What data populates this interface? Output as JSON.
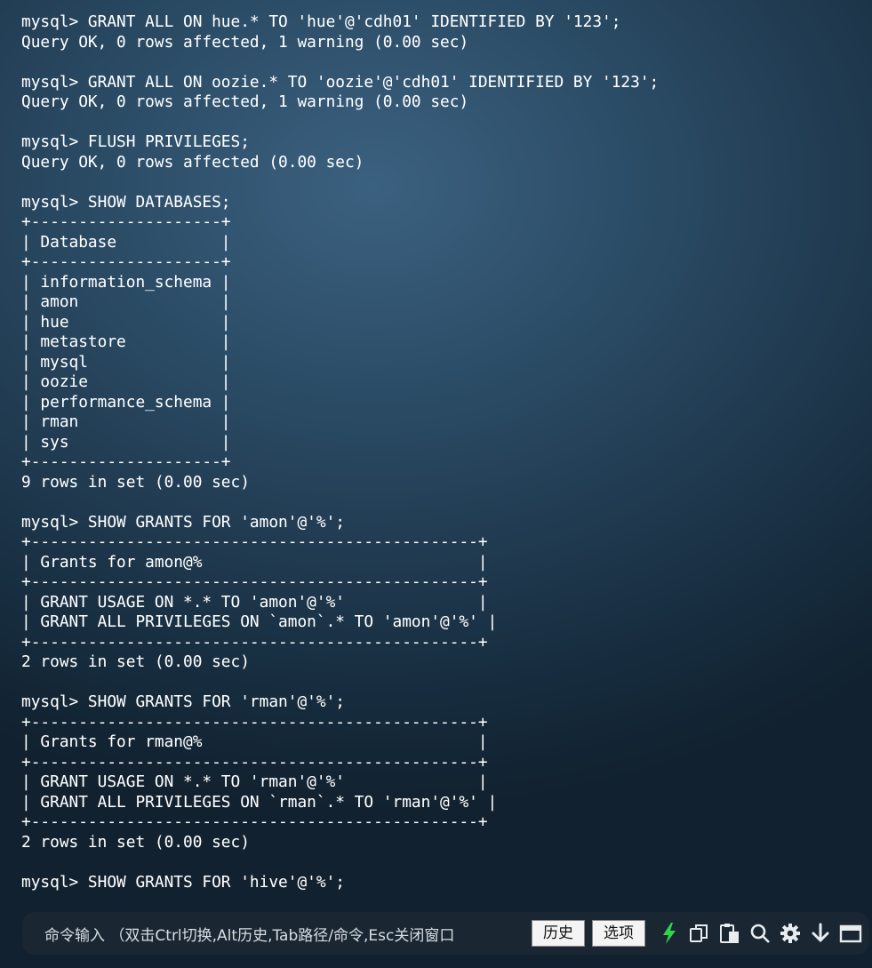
{
  "terminal": {
    "lines": [
      "mysql> GRANT ALL ON hue.* TO 'hue'@'cdh01' IDENTIFIED BY '123';",
      "Query OK, 0 rows affected, 1 warning (0.00 sec)",
      "",
      "mysql> GRANT ALL ON oozie.* TO 'oozie'@'cdh01' IDENTIFIED BY '123';",
      "Query OK, 0 rows affected, 1 warning (0.00 sec)",
      "",
      "mysql> FLUSH PRIVILEGES;",
      "Query OK, 0 rows affected (0.00 sec)",
      "",
      "mysql> SHOW DATABASES;",
      "+--------------------+",
      "| Database           |",
      "+--------------------+",
      "| information_schema |",
      "| amon               |",
      "| hue                |",
      "| metastore          |",
      "| mysql              |",
      "| oozie              |",
      "| performance_schema |",
      "| rman               |",
      "| sys                |",
      "+--------------------+",
      "9 rows in set (0.00 sec)",
      "",
      "mysql> SHOW GRANTS FOR 'amon'@'%';",
      "+-----------------------------------------------+",
      "| Grants for amon@%                             |",
      "+-----------------------------------------------+",
      "| GRANT USAGE ON *.* TO 'amon'@'%'              |",
      "| GRANT ALL PRIVILEGES ON `amon`.* TO 'amon'@'%' |",
      "+-----------------------------------------------+",
      "2 rows in set (0.00 sec)",
      "",
      "mysql> SHOW GRANTS FOR 'rman'@'%';",
      "+-----------------------------------------------+",
      "| Grants for rman@%                             |",
      "+-----------------------------------------------+",
      "| GRANT USAGE ON *.* TO 'rman'@'%'              |",
      "| GRANT ALL PRIVILEGES ON `rman`.* TO 'rman'@'%' |",
      "+-----------------------------------------------+",
      "2 rows in set (0.00 sec)",
      "",
      "mysql> SHOW GRANTS FOR 'hive'@'%';"
    ]
  },
  "command_bar": {
    "hint": "命令输入 （双击Ctrl切换,Alt历史,Tab路径/命令,Esc关闭窗口",
    "history_label": "历史",
    "options_label": "选项",
    "icons": [
      "lightning-icon",
      "copy-icon",
      "paste-icon",
      "search-icon",
      "gear-icon",
      "download-icon",
      "window-icon"
    ]
  },
  "colors": {
    "text": "#ffffff",
    "command_bar_bg": "#1a2733",
    "lightning": "#2fd34a",
    "icon": "#e8ecef"
  }
}
